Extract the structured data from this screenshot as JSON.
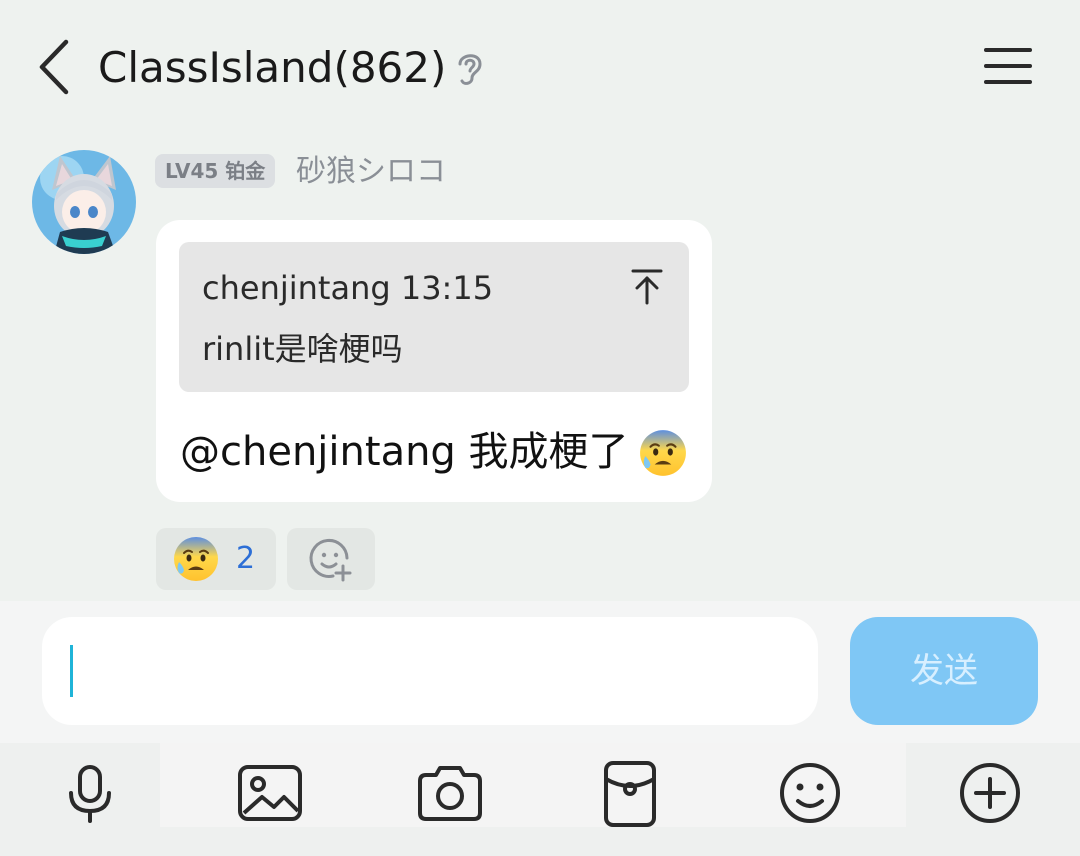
{
  "header": {
    "title": "ClassIsland(862)",
    "back_icon": "back-chevron-icon",
    "ear_icon": "ear-icon",
    "menu_icon": "hamburger-menu-icon"
  },
  "message": {
    "level_badge": "LV45 铂金",
    "sender_name": "砂狼シロコ",
    "quote": {
      "author_time": "chenjintang 13:15",
      "text": "rinlit是啥梗吗",
      "jump_icon": "arrow-up-to-top-icon"
    },
    "text": "@chenjintang 我成梗了",
    "emoji": "anxious-face-with-sweat"
  },
  "reactions": [
    {
      "emoji": "anxious-face-with-sweat",
      "count": "2"
    }
  ],
  "add_reaction_icon": "add-reaction-icon",
  "composer": {
    "input_value": "",
    "send_label": "发送"
  },
  "toolbar": {
    "items": [
      "microphone-icon",
      "image-icon",
      "camera-icon",
      "red-packet-icon",
      "emoji-icon",
      "plus-circle-icon"
    ]
  },
  "colors": {
    "background": "#eef2ef",
    "send_button": "#7fc7f5",
    "reaction_count": "#2d6fd6",
    "caret": "#1fb4d8"
  }
}
